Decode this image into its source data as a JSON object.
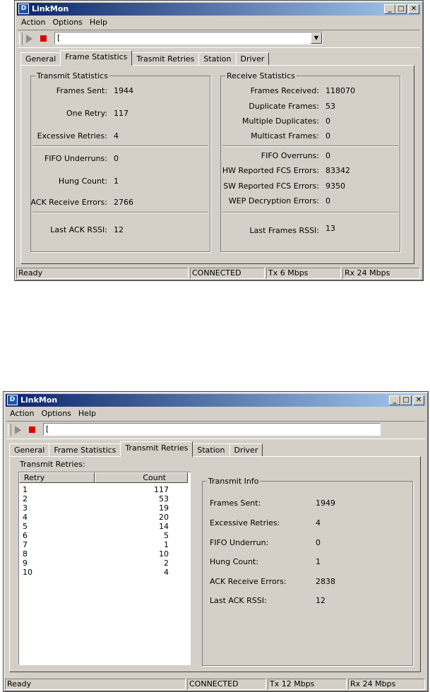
{
  "app_title": "LinkMon",
  "app_icon_glyph": "D",
  "title_buttons": {
    "minimize": "_",
    "maximize": "□",
    "close": "✕"
  },
  "menu": [
    "Action",
    "Options",
    "Help"
  ],
  "toolbar": {
    "combo_value": "[",
    "combo_arrow": "▼"
  },
  "tabs": [
    "General",
    "Frame Statistics",
    "Trasmit Retries",
    "Station",
    "Driver"
  ],
  "window1": {
    "active_tab": "Frame Statistics",
    "transmit": {
      "title": "Transmit Statistics",
      "rows": [
        {
          "label": "Frames Sent:",
          "value": "1944"
        },
        {
          "label": "One Retry:",
          "value": "117"
        },
        {
          "label": "Excessive Retries:",
          "value": "4"
        },
        {
          "label": "FIFO Underruns:",
          "value": "0"
        },
        {
          "label": "Hung Count:",
          "value": "1"
        },
        {
          "label": "ACK Receive Errors:",
          "value": "2766"
        },
        {
          "label": "Last ACK RSSI:",
          "value": "12"
        }
      ]
    },
    "receive": {
      "title": "Receive Statistics",
      "rows": [
        {
          "label": "Frames Received:",
          "value": "118070"
        },
        {
          "label": "Duplicate Frames:",
          "value": "53"
        },
        {
          "label": "Multiple Duplicates:",
          "value": "0"
        },
        {
          "label": "Multicast Frames:",
          "value": "0"
        },
        {
          "label": "FIFO Overruns:",
          "value": "0"
        },
        {
          "label": "HW Reported FCS Errors:",
          "value": "83342"
        },
        {
          "label": "SW Reported FCS Errors:",
          "value": "9350"
        },
        {
          "label": "WEP Decryption Errors:",
          "value": "0"
        },
        {
          "label": "Last Frames RSSI:",
          "value": "13"
        }
      ]
    },
    "status": {
      "text": "Ready",
      "conn": "CONNECTED",
      "tx": "Tx 6 Mbps",
      "rx": "Rx 24 Mbps"
    }
  },
  "window2": {
    "tabs": [
      "General",
      "Frame Statistics",
      "Transmit Retries",
      "Station",
      "Driver"
    ],
    "active_tab": "Transmit Retries",
    "retries_label": "Transmit Retries:",
    "columns": [
      "Retry",
      "Count"
    ],
    "retries": [
      {
        "retry": "1",
        "count": "117"
      },
      {
        "retry": "2",
        "count": "53"
      },
      {
        "retry": "3",
        "count": "19"
      },
      {
        "retry": "4",
        "count": "20"
      },
      {
        "retry": "5",
        "count": "14"
      },
      {
        "retry": "6",
        "count": "5"
      },
      {
        "retry": "7",
        "count": "1"
      },
      {
        "retry": "8",
        "count": "10"
      },
      {
        "retry": "9",
        "count": "2"
      },
      {
        "retry": "10",
        "count": "4"
      }
    ],
    "info": {
      "title": "Transmit Info",
      "rows": [
        {
          "label": "Frames Sent:",
          "value": "1949"
        },
        {
          "label": "Excessive Retries:",
          "value": "4"
        },
        {
          "label": "FIFO Underrun:",
          "value": "0"
        },
        {
          "label": "Hung Count:",
          "value": "1"
        },
        {
          "label": "ACK Receive Errors:",
          "value": "2838"
        },
        {
          "label": "Last ACK RSSI:",
          "value": "12"
        }
      ]
    },
    "status": {
      "text": "Ready",
      "conn": "CONNECTED",
      "tx": "Tx 12 Mbps",
      "rx": "Rx 24 Mbps"
    }
  }
}
